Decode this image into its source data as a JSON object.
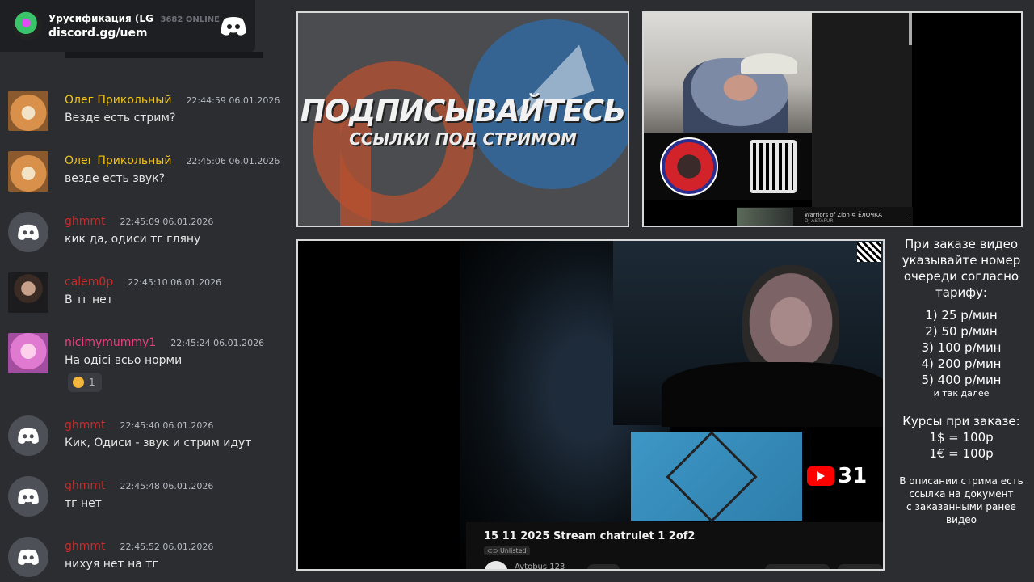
{
  "discord_widget": {
    "server_name": "Урусификация (LG...",
    "online": "3682 ONLINE",
    "invite": "discord.gg/uem"
  },
  "messages": [
    {
      "user": "Олег Прикольный",
      "time": "22:44:59 06.01.2026",
      "text": "Везде есть стрим?",
      "avatar": "doge",
      "color": "gold"
    },
    {
      "user": "Олег Прикольный",
      "time": "22:45:06 06.01.2026",
      "text": "везде есть звук?",
      "avatar": "doge",
      "color": "gold"
    },
    {
      "user": "ghmmt",
      "time": "22:45:09 06.01.2026",
      "text": "кик да, одиси тг гляну",
      "avatar": "discord",
      "color": "red"
    },
    {
      "user": "calem0p",
      "time": "22:45:10 06.01.2026",
      "text": "В тг нет",
      "avatar": "man",
      "color": "red"
    },
    {
      "user": "nicimymummy1",
      "time": "22:45:24 06.01.2026",
      "text": "На одісі всьо норми",
      "avatar": "anime",
      "color": "pink",
      "reaction_count": "1"
    },
    {
      "user": "ghmmt",
      "time": "22:45:40 06.01.2026",
      "text": "Кик, Одиси - звук и стрим идут",
      "avatar": "discord",
      "color": "red"
    },
    {
      "user": "ghmmt",
      "time": "22:45:48 06.01.2026",
      "text": "тг нет",
      "avatar": "discord",
      "color": "red"
    },
    {
      "user": "ghmmt",
      "time": "22:45:52 06.01.2026",
      "text": "нихуя нет на тг",
      "avatar": "discord",
      "color": "red"
    }
  ],
  "subscribe_panel": {
    "title": "ПОДПИСЫВАЙТЕСЬ",
    "subtitle": "ССЫЛКИ ПОД СТРИМОМ"
  },
  "music": {
    "song": "Warriors of Zion ✡ ЁЛОЧКА",
    "artist": "DJ ASTAFUR"
  },
  "main_video": {
    "title": "15 11 2025 Stream chatrulet 1 2of2",
    "visibility": "Unlisted",
    "channel": "Avtobus 123",
    "yt_count": "31"
  },
  "info": {
    "order_heading": [
      "При заказе видео",
      "указывайте номер",
      "очереди согласно",
      "тарифу:"
    ],
    "tariffs": [
      "1) 25 р/мин",
      "2) 50 р/мин",
      "3) 100 р/мин",
      "4) 200 р/мин",
      "5) 400 р/мин"
    ],
    "etc": "и так далее",
    "rates_heading": "Курсы при заказе:",
    "rates": [
      "1$ = 100р",
      "1€ = 100р"
    ],
    "doc_note": [
      "В описании стрима есть",
      "ссылка на документ",
      "с заказанными ранее",
      "видео"
    ]
  },
  "colors": {
    "background": "#2b2d31",
    "username_gold": "#f0c419",
    "username_red": "#c92a2a",
    "username_pink": "#e8417a"
  }
}
